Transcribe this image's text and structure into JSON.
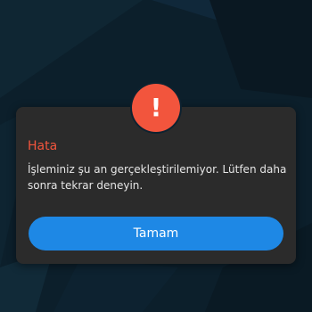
{
  "colors": {
    "accent": "#f2553d",
    "button": "#1e88e5",
    "dialog_bg": "#2b2b2b",
    "text": "#e6e6e6"
  },
  "dialog": {
    "icon": "exclamation-icon",
    "icon_glyph": "!",
    "title": "Hata",
    "message": "İşleminiz şu an gerçekleştirilemiyor. Lütfen daha sonra tekrar deneyin.",
    "button_label": "Tamam"
  }
}
